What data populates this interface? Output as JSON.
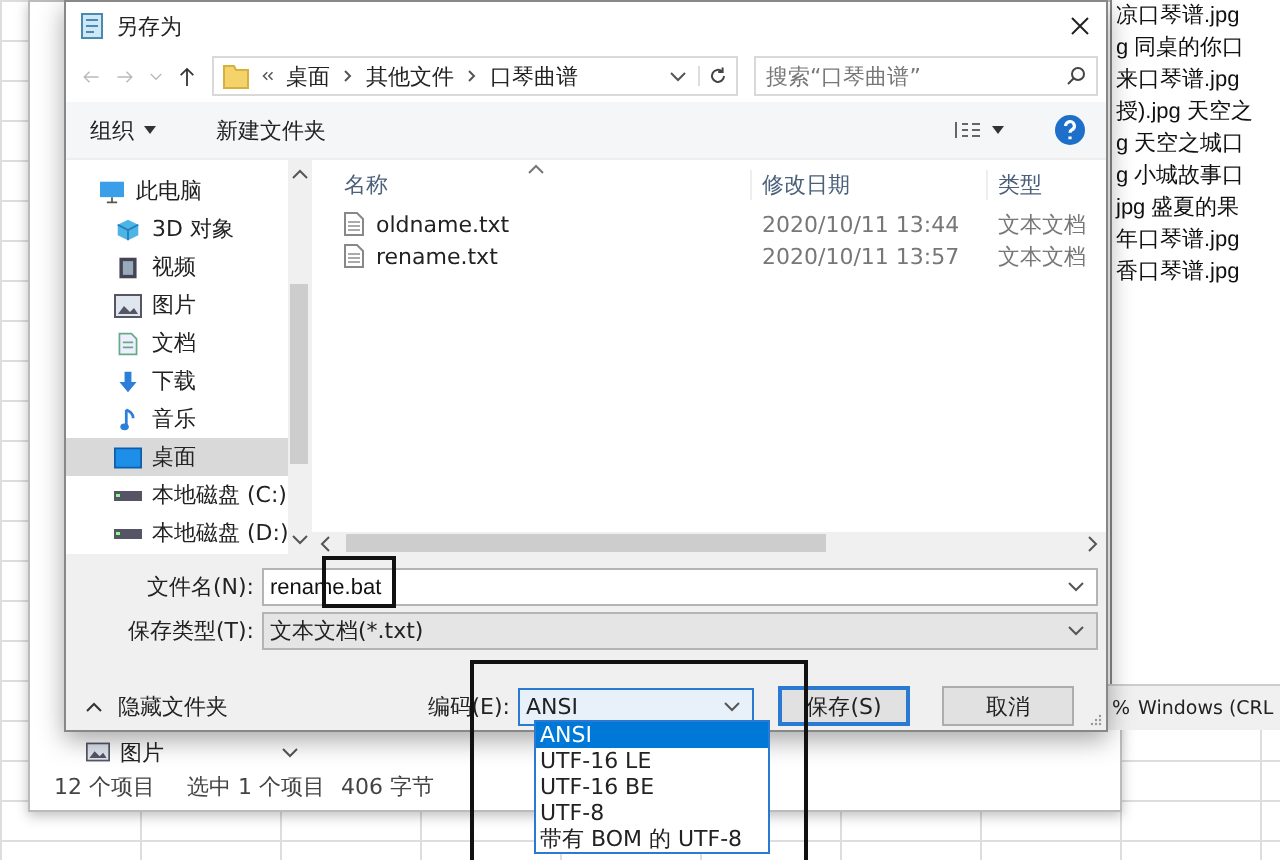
{
  "notepad": {
    "lines": [
      "凉口琴谱.jpg",
      "g 同桌的你口",
      "来口琴谱.jpg",
      "授).jpg 天空之",
      "g 天空之城口",
      "g 小城故事口",
      "jpg 盛夏的果",
      "年口琴谱.jpg",
      "香口琴谱.jpg"
    ],
    "status": [
      "%",
      "Windows (CRL"
    ]
  },
  "explorer": {
    "sidebar_item": "图片",
    "status_bar": [
      "12 个项目",
      "选中 1 个项目",
      "406 字节"
    ]
  },
  "dialog": {
    "title": "另存为",
    "breadcrumb": [
      "桌面",
      "其他文件",
      "口琴曲谱"
    ],
    "search": {
      "placeholder": "搜索“口琴曲谱”"
    },
    "toolbar": {
      "organize": "组织",
      "new_folder": "新建文件夹"
    },
    "sidebar": [
      {
        "label": "此电脑",
        "kind": "pc",
        "selected": false
      },
      {
        "label": "3D 对象",
        "kind": "cube",
        "selected": false
      },
      {
        "label": "视频",
        "kind": "video",
        "selected": false
      },
      {
        "label": "图片",
        "kind": "pictures",
        "selected": false
      },
      {
        "label": "文档",
        "kind": "documents",
        "selected": false
      },
      {
        "label": "下载",
        "kind": "downloads",
        "selected": false
      },
      {
        "label": "音乐",
        "kind": "music",
        "selected": false
      },
      {
        "label": "桌面",
        "kind": "desktop",
        "selected": true
      },
      {
        "label": "本地磁盘 (C:)",
        "kind": "disk",
        "selected": false
      },
      {
        "label": "本地磁盘 (D:)",
        "kind": "disk",
        "selected": false
      }
    ],
    "columns": [
      "名称",
      "修改日期",
      "类型"
    ],
    "files": [
      {
        "name": "oldname.txt",
        "modified": "2020/10/11 13:44",
        "type": "文本文档"
      },
      {
        "name": "rename.txt",
        "modified": "2020/10/11 13:57",
        "type": "文本文档"
      }
    ],
    "file_name": {
      "label": "文件名(N):",
      "value": "rename.bat"
    },
    "save_type": {
      "label": "保存类型(T):",
      "value": "文本文档(*.txt)"
    },
    "hide_folders": "隐藏文件夹",
    "encoding": {
      "label": "编码(E):",
      "value": "ANSI",
      "options": [
        {
          "label": "ANSI",
          "selected": true
        },
        {
          "label": "UTF-16 LE",
          "selected": false
        },
        {
          "label": "UTF-16 BE",
          "selected": false
        },
        {
          "label": "UTF-8",
          "selected": false
        },
        {
          "label": "带有 BOM 的 UTF-8",
          "selected": false
        }
      ]
    },
    "buttons": {
      "save": "保存(S)",
      "cancel": "取消"
    }
  }
}
